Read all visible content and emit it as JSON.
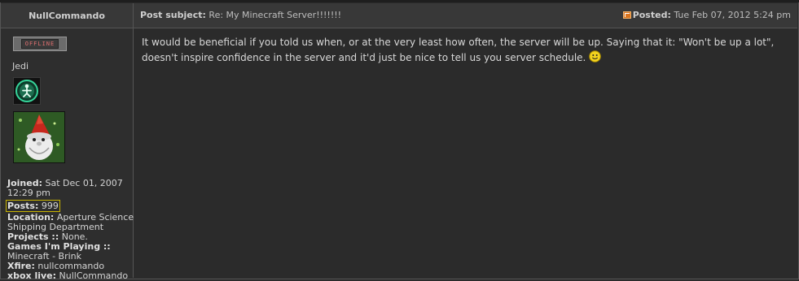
{
  "author": {
    "username": "NullCommando",
    "status_badge": "OFFLINE",
    "rank": "Jedi"
  },
  "post": {
    "subject_label": "Post subject:",
    "subject": "Re: My Minecraft Server!!!!!!!",
    "posted_label": "Posted:",
    "posted_date": "Tue Feb 07, 2012 5:24 pm",
    "body": "It would be beneficial if you told us when, or at the very least how often, the server will be up. Saying that it: \"Won't be up a lot\", doesn't inspire confidence in the server and it'd just be nice to tell us you server schedule."
  },
  "profile": {
    "joined_label": "Joined:",
    "joined_value": "Sat Dec 01, 2007",
    "joined_time": "12:29 pm",
    "posts_label": "Posts:",
    "posts_value": "999",
    "location_label": "Location:",
    "location_value_1": "Aperture Science",
    "location_value_2": "Shipping Department",
    "projects_label": "Projects ::",
    "projects_value": "None.",
    "games_label": "Games I'm Playing ::",
    "games_value": "Minecraft - Brink",
    "xfire_label": "Xfire:",
    "xfire_value": "nullcommando",
    "xbox_label": "xbox live:",
    "xbox_value": "NullCommando"
  },
  "icons": {
    "post_icon": "post-link-icon",
    "smiley": "smile-icon",
    "rank_icon": "jedi-rank-icon"
  },
  "colors": {
    "background": "#2b2b2b",
    "header": "#383838",
    "posts_highlight": "#c9b400"
  }
}
